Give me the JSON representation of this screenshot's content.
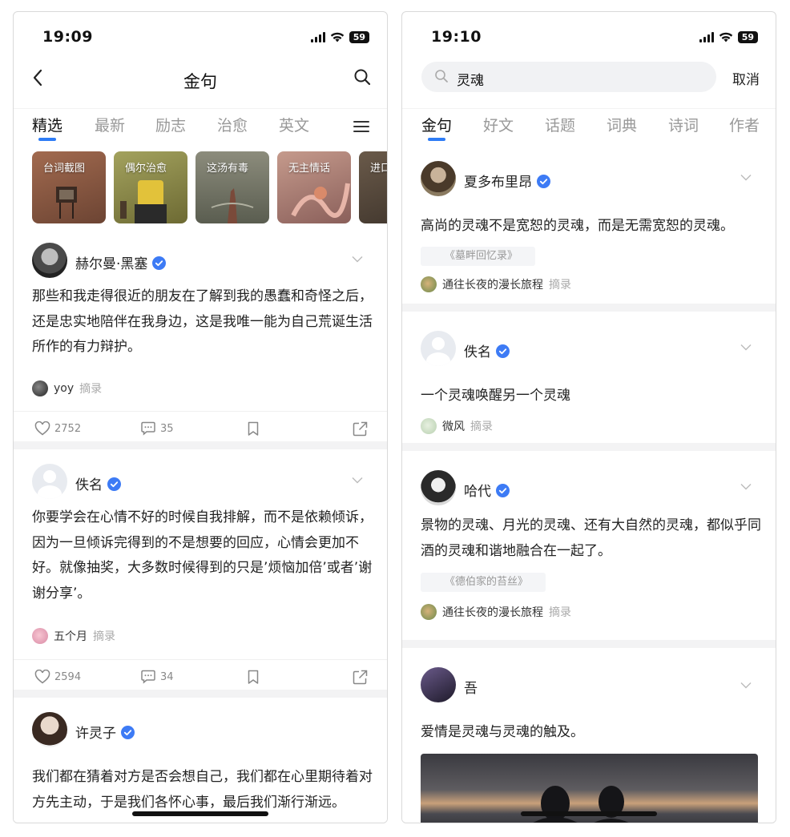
{
  "left_screen": {
    "status": {
      "time": "19:09",
      "battery": "59"
    },
    "nav": {
      "title": "金句"
    },
    "tabs": [
      "精选",
      "最新",
      "励志",
      "治愈",
      "英文"
    ],
    "categories": [
      {
        "label": "台词截图",
        "color": "#8a5a44"
      },
      {
        "label": "偶尔治愈",
        "color": "#8b8a3c"
      },
      {
        "label": "这汤有毒",
        "color": "#6f6e5e"
      },
      {
        "label": "无主情话",
        "color": "#b7706c"
      },
      {
        "label": "进口",
        "color": "#5a4a3e"
      }
    ],
    "posts": [
      {
        "author": "赫尔曼·黑塞",
        "quote": "那些和我走得很近的朋友在了解到我的愚蠢和奇怪之后，还是忠实地陪伴在我身边，这是我唯一能为自己荒诞生活所作的有力辩护。",
        "poster": "yoy",
        "tag": "摘录",
        "likes": "2752",
        "comments": "35"
      },
      {
        "author": "佚名",
        "quote": "你要学会在心情不好的时候自我排解，而不是依赖倾诉，因为一旦倾诉完得到的不是想要的回应，心情会更加不好。就像抽奖，大多数时候得到的只是’烦恼加倍’或者’谢谢分享’。",
        "poster": "五个月",
        "tag": "摘录",
        "likes": "2594",
        "comments": "34"
      },
      {
        "author": "许灵子",
        "quote": "我们都在猜着对方是否会想自己，我们都在心里期待着对方先主动，于是我们各怀心事，最后我们渐行渐远。"
      }
    ]
  },
  "right_screen": {
    "status": {
      "time": "19:10",
      "battery": "59"
    },
    "search": {
      "value": "灵魂",
      "cancel": "取消"
    },
    "tabs": [
      "金句",
      "好文",
      "话题",
      "词典",
      "诗词",
      "作者"
    ],
    "posts": [
      {
        "author": "夏多布里昂",
        "quote": "高尚的灵魂不是宽恕的灵魂，而是无需宽恕的灵魂。",
        "source": "《墓畔回忆录》",
        "poster": "通往长夜的漫长旅程",
        "tag": "摘录"
      },
      {
        "author": "佚名",
        "quote": "一个灵魂唤醒另一个灵魂",
        "poster": "微风",
        "tag": "摘录"
      },
      {
        "author": "哈代",
        "quote": "景物的灵魂、月光的灵魂、还有大自然的灵魂，都似乎同酒的灵魂和谐地融合在一起了。",
        "source": "《德伯家的苔丝》",
        "poster": "通往长夜的漫长旅程",
        "tag": "摘录"
      },
      {
        "author": "吾",
        "quote": "爱情是灵魂与灵魂的触及。"
      }
    ]
  }
}
